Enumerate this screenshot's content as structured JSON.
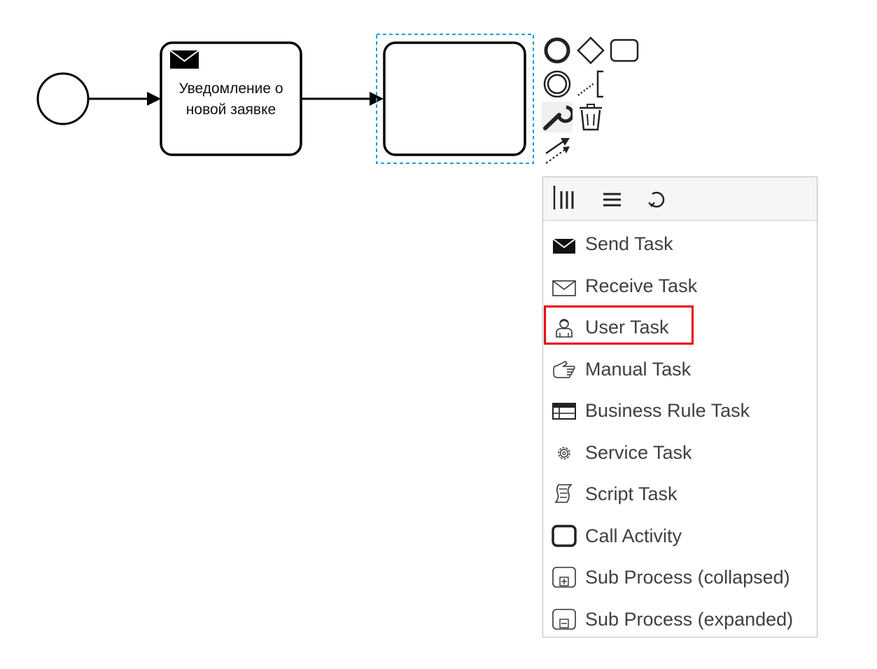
{
  "diagram": {
    "task_label": "Уведомление о новой заявке"
  },
  "context_pad": {
    "entries": [
      {
        "name": "append-end-event",
        "icon": "end-event-icon"
      },
      {
        "name": "append-gateway",
        "icon": "gateway-icon"
      },
      {
        "name": "append-task",
        "icon": "task-icon"
      },
      {
        "name": "append-intermediate-event",
        "icon": "intermediate-event-icon"
      },
      {
        "name": "append-text-annotation",
        "icon": "text-annotation-icon"
      },
      {
        "name": "change-type",
        "icon": "wrench-icon"
      },
      {
        "name": "delete",
        "icon": "trash-icon"
      },
      {
        "name": "connect",
        "icon": "connect-icon"
      }
    ]
  },
  "popup_menu": {
    "header_buttons": [
      {
        "name": "parallel-multi-instance",
        "icon": "parallel-mi-icon"
      },
      {
        "name": "sequential-multi-instance",
        "icon": "sequential-mi-icon"
      },
      {
        "name": "loop",
        "icon": "loop-icon"
      }
    ],
    "items": [
      {
        "label": "Send Task",
        "icon": "send-task-icon"
      },
      {
        "label": "Receive Task",
        "icon": "receive-task-icon"
      },
      {
        "label": "User Task",
        "icon": "user-task-icon"
      },
      {
        "label": "Manual Task",
        "icon": "manual-task-icon"
      },
      {
        "label": "Business Rule Task",
        "icon": "business-rule-task-icon"
      },
      {
        "label": "Service Task",
        "icon": "service-task-icon"
      },
      {
        "label": "Script Task",
        "icon": "script-task-icon"
      },
      {
        "label": "Call Activity",
        "icon": "call-activity-icon"
      },
      {
        "label": "Sub Process (collapsed)",
        "icon": "subprocess-collapsed-icon"
      },
      {
        "label": "Sub Process (expanded)",
        "icon": "subprocess-expanded-icon"
      }
    ],
    "highlighted_item": "User Task",
    "highlight_color": "#e8000b"
  },
  "colors": {
    "selection": "#1e9be0",
    "stroke": "#000000",
    "menu_text": "#3f3f3f"
  }
}
